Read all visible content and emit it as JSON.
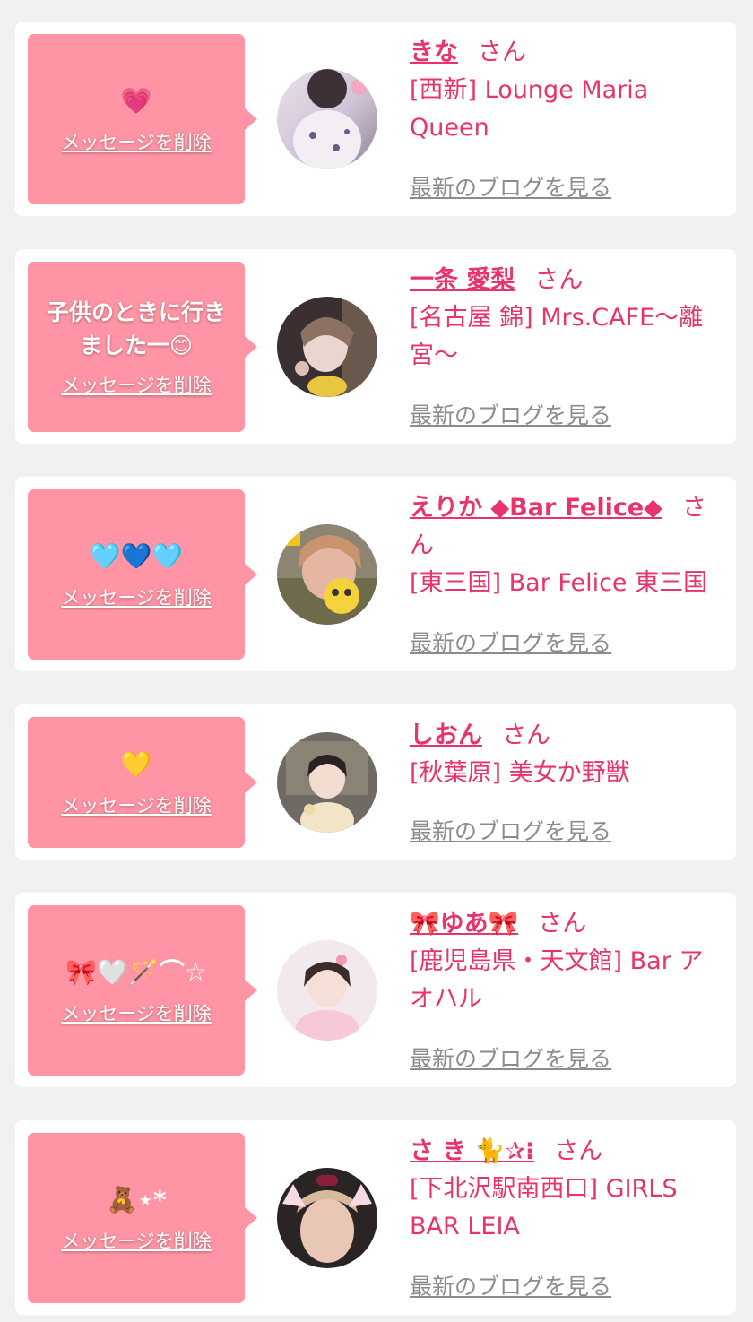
{
  "common": {
    "delete_label": "メッセージを削除",
    "blog_label": "最新のブログを見る",
    "suffix": "さん"
  },
  "cards": [
    {
      "message": "💗",
      "name": "きな",
      "shop": "[西新] Lounge Maria Queen"
    },
    {
      "message": "子供のときに行きました一😊",
      "name": "一条 愛梨",
      "shop": "[名古屋 錦] Mrs.CAFE〜離宮〜"
    },
    {
      "message": "🩵💙🩵",
      "name": "えりか ◆Bar Felice◆",
      "shop": "[東三国] Bar Felice 東三国"
    },
    {
      "message": "💛",
      "name": "しおん",
      "shop": "[秋葉原] 美女か野獣"
    },
    {
      "message": "🎀🤍🪄⌒☆",
      "name": "🎀ゆあ🎀",
      "shop": "[鹿児島県・天文館] Bar アオハル"
    },
    {
      "message": "🧸⋆*",
      "name": "さ き 🐈✰⁝",
      "shop": "[下北沢駅南西口] GIRLS BAR LEIA"
    }
  ],
  "colors": {
    "page_bg": "#f1f1f1",
    "bubble": "#ff95a4",
    "accent": "#e8336b",
    "link_gray": "#8c8c8c"
  }
}
